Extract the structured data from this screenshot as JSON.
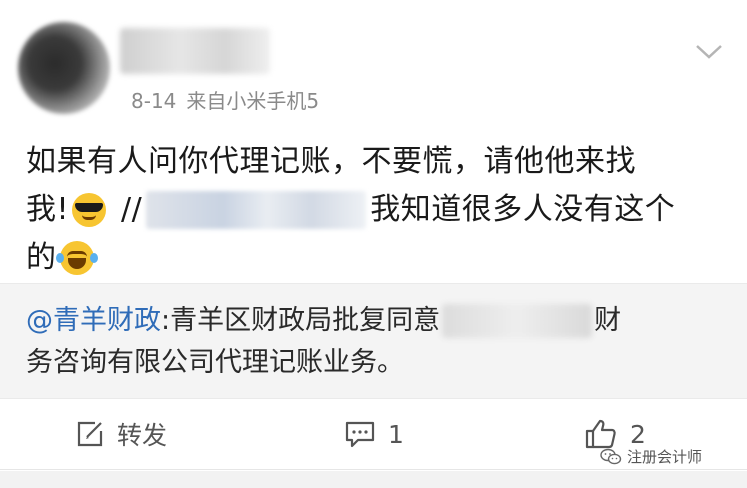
{
  "post": {
    "date": "8-14",
    "source": "来自小米手机5",
    "content_lines": {
      "line1": "如果有人问你代理记账，不要慌，请他他来找",
      "line2_start": "我!",
      "line2_slashes": "//",
      "line2_end": "我知道很多人没有这个",
      "line3": "的"
    },
    "emojis": {
      "first": "cool-sunglasses-emoji",
      "second": "laughing-tears-emoji"
    }
  },
  "repost": {
    "at_user": "@青羊财政",
    "line1_text": ":青羊区财政局批复同意",
    "line1_tail": "财",
    "line2_text": "务咨询有限公司代理记账业务。"
  },
  "actions": {
    "repost_label": "转发",
    "comment_count": "1",
    "like_count": "2"
  },
  "watermark": {
    "label": "注册会计师"
  },
  "icons": {
    "chevron": "chevron-down-icon",
    "repost": "edit-share-icon",
    "comment": "comment-icon",
    "like": "thumbs-up-icon",
    "watermark": "wechat-icon"
  },
  "colors": {
    "link": "#2f6cb8",
    "meta": "#8a8a8a",
    "repost_bg": "#f4f4f4"
  }
}
